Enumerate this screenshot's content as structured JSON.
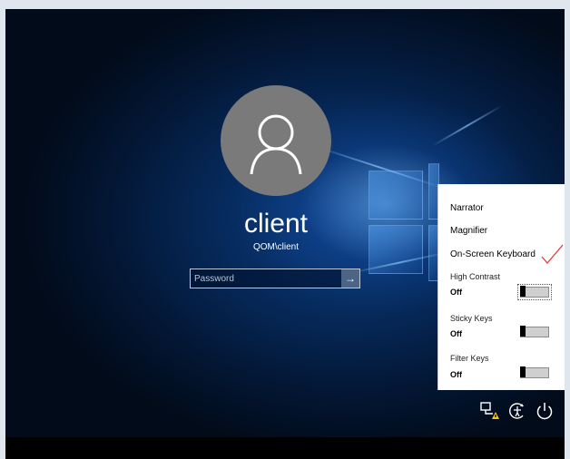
{
  "user": {
    "display_name": "client",
    "account_name": "QOM\\client"
  },
  "login": {
    "password_placeholder": "Password",
    "submit_glyph": "→"
  },
  "ease_of_access_menu": {
    "items": [
      {
        "label": "Narrator"
      },
      {
        "label": "Magnifier"
      },
      {
        "label": "On-Screen Keyboard"
      }
    ],
    "toggles": [
      {
        "label": "High Contrast",
        "state": "Off",
        "on": false,
        "focused": true
      },
      {
        "label": "Sticky Keys",
        "state": "Off",
        "on": false,
        "focused": false
      },
      {
        "label": "Filter Keys",
        "state": "Off",
        "on": false,
        "focused": false
      }
    ]
  },
  "bottom_icons": [
    "network-icon",
    "ease-of-access-icon",
    "power-icon"
  ],
  "colors": {
    "avatar_bg": "#7a7a7a",
    "menu_bg": "#ffffff",
    "annotation_check": "#e53935",
    "network_warning": "#f5c518"
  }
}
